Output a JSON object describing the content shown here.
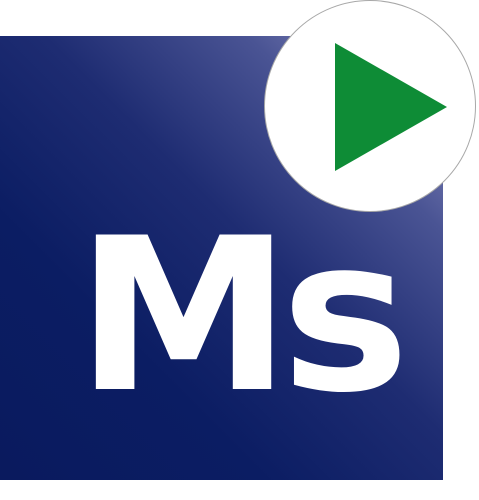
{
  "app_icon": {
    "logo_text": "Ms",
    "tile_color": "#0a1a5e",
    "tile_highlight_color": "#9a9ac8",
    "text_color": "#ffffff",
    "badge": {
      "icon": "play-icon",
      "background_color": "#ffffff",
      "border_color": "#a8a8a8",
      "icon_color": "#0e8c36"
    }
  }
}
